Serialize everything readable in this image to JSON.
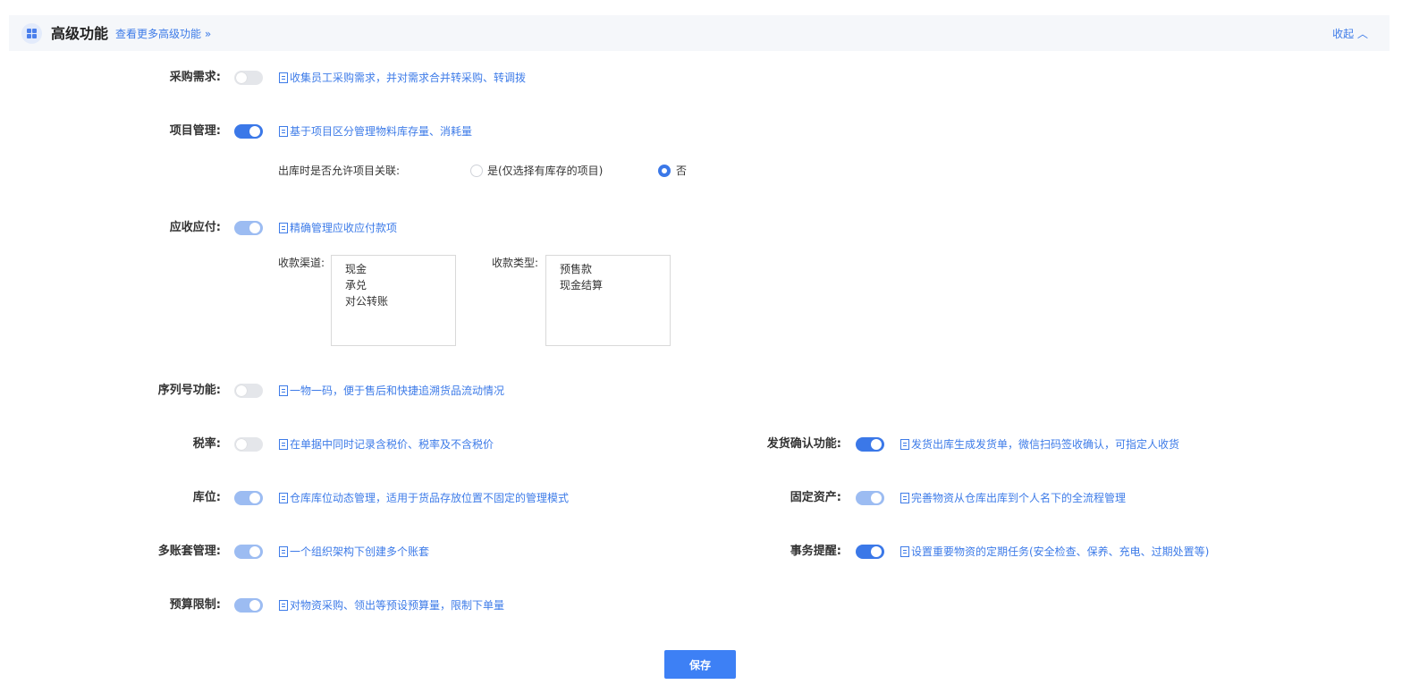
{
  "header": {
    "title": "高级功能",
    "more_link": "查看更多高级功能 »",
    "collapse": "收起 ︿"
  },
  "features": {
    "purchase_request": {
      "label": "采购需求:",
      "desc": "收集员工采购需求，并对需求合并转采购、转调拨",
      "state": "off"
    },
    "project_mgmt": {
      "label": "项目管理:",
      "desc": "基于项目区分管理物料库存量、消耗量",
      "state": "on",
      "outbound_question": "出库时是否允许项目关联:",
      "option_yes": "是(仅选择有库存的项目)",
      "option_no": "否",
      "selected": "否"
    },
    "receivable_payable": {
      "label": "应收应付:",
      "desc": "精确管理应收应付款项",
      "state": "on-disabled",
      "channel_label": "收款渠道:",
      "channels": [
        "现金",
        "承兑",
        "对公转账"
      ],
      "type_label": "收款类型:",
      "types": [
        "预售款",
        "现金结算"
      ]
    },
    "serial_number": {
      "label": "序列号功能:",
      "desc": "一物一码，便于售后和快捷追溯货品流动情况",
      "state": "off"
    },
    "tax_rate": {
      "label": "税率:",
      "desc": "在单据中同时记录含税价、税率及不含税价",
      "state": "off"
    },
    "location": {
      "label": "库位:",
      "desc": "仓库库位动态管理，适用于货品存放位置不固定的管理模式",
      "state": "on-disabled"
    },
    "multi_account": {
      "label": "多账套管理:",
      "desc": "一个组织架构下创建多个账套",
      "state": "on-disabled"
    },
    "budget_limit": {
      "label": "预算限制:",
      "desc": "对物资采购、领出等预设预算量，限制下单量",
      "state": "on-disabled"
    },
    "delivery_confirm": {
      "label": "发货确认功能:",
      "desc": "发货出库生成发货单，微信扫码签收确认，可指定人收货",
      "state": "on"
    },
    "fixed_assets": {
      "label": "固定资产:",
      "desc": "完善物资从仓库出库到个人名下的全流程管理",
      "state": "on-disabled"
    },
    "task_reminder": {
      "label": "事务提醒:",
      "desc": "设置重要物资的定期任务(安全检查、保养、充电、过期处置等)",
      "state": "on"
    }
  },
  "save_label": "保存",
  "colors": {
    "accent": "#3b78e8",
    "accent_light": "#9cbcf2",
    "link": "#3d7be8",
    "header_bg": "#f5f7fa"
  }
}
